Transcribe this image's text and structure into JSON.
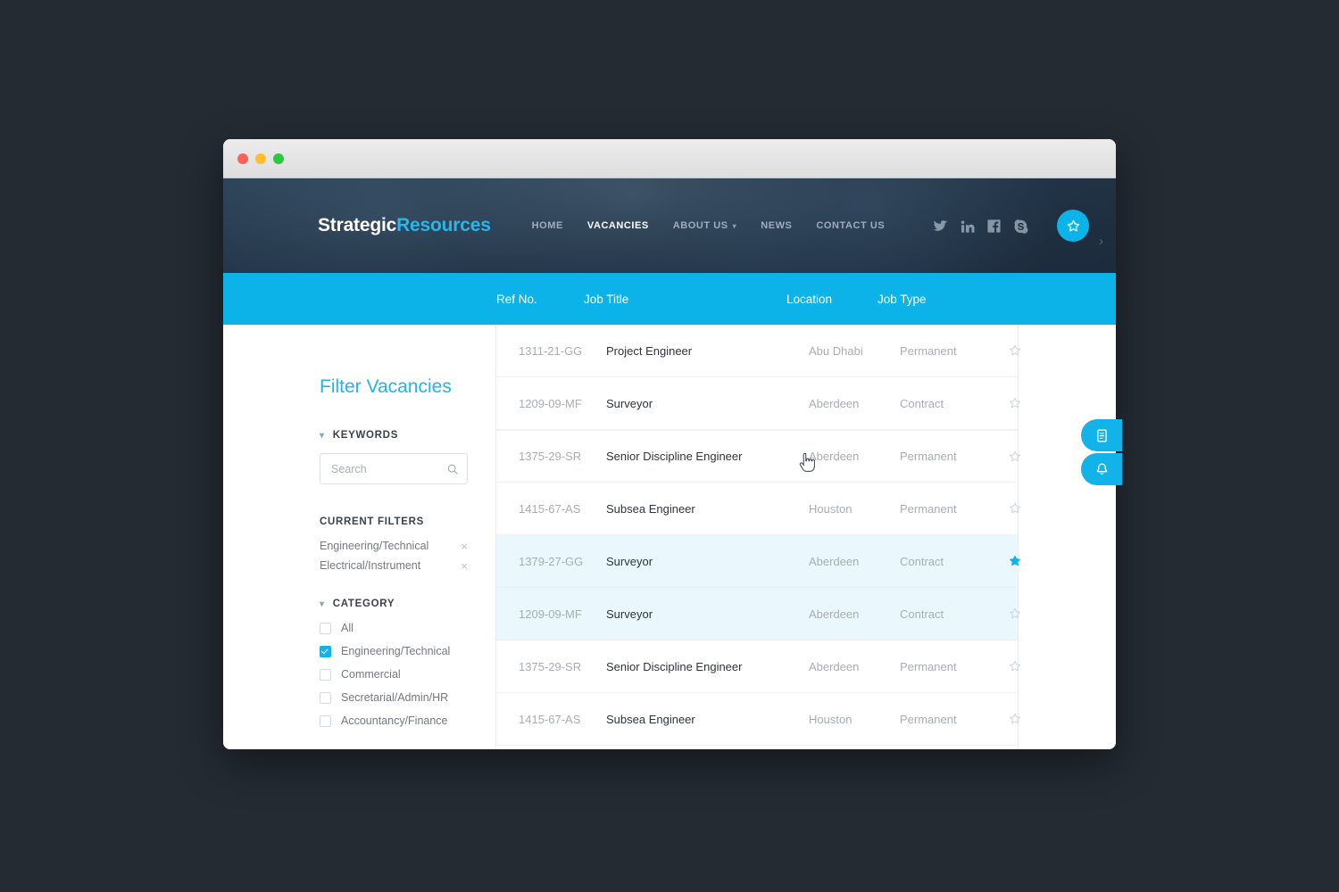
{
  "window": {
    "traffic_lights": [
      "close",
      "minimize",
      "maximize"
    ]
  },
  "header": {
    "brand_primary": "Strategic",
    "brand_secondary": "Resources",
    "nav": [
      {
        "label": "HOME",
        "active": false,
        "caret": false
      },
      {
        "label": "VACANCIES",
        "active": true,
        "caret": false
      },
      {
        "label": "ABOUT US",
        "active": false,
        "caret": true
      },
      {
        "label": "NEWS",
        "active": false,
        "caret": false
      },
      {
        "label": "CONTACT US",
        "active": false,
        "caret": false
      }
    ],
    "social": [
      "twitter-icon",
      "linkedin-icon",
      "facebook-icon",
      "skype-icon"
    ],
    "star_button_icon": "star-outline-icon",
    "carousel_next": "›"
  },
  "table": {
    "columns": [
      "Ref No.",
      "Job Title",
      "Location",
      "Job Type"
    ],
    "rows": [
      {
        "ref": "1311-21-GG",
        "title": "Project Engineer",
        "location": "Abu Dhabi",
        "type": "Permanent",
        "starred": false,
        "state": "normal"
      },
      {
        "ref": "1209-09-MF",
        "title": "Surveyor",
        "location": "Aberdeen",
        "type": "Contract",
        "starred": false,
        "state": "normal"
      },
      {
        "ref": "1375-29-SR",
        "title": "Senior Discipline Engineer",
        "location": "Aberdeen",
        "type": "Permanent",
        "starred": false,
        "state": "hovered"
      },
      {
        "ref": "1415-67-AS",
        "title": "Subsea Engineer",
        "location": "Houston",
        "type": "Permanent",
        "starred": false,
        "state": "normal"
      },
      {
        "ref": "1379-27-GG",
        "title": "Surveyor",
        "location": "Aberdeen",
        "type": "Contract",
        "starred": true,
        "state": "selected"
      },
      {
        "ref": "1209-09-MF",
        "title": "Surveyor",
        "location": "Aberdeen",
        "type": "Contract",
        "starred": false,
        "state": "selected"
      },
      {
        "ref": "1375-29-SR",
        "title": "Senior Discipline Engineer",
        "location": "Aberdeen",
        "type": "Permanent",
        "starred": false,
        "state": "normal"
      },
      {
        "ref": "1415-67-AS",
        "title": "Subsea Engineer",
        "location": "Houston",
        "type": "Permanent",
        "starred": false,
        "state": "normal"
      }
    ]
  },
  "sidebar": {
    "title": "Filter Vacancies",
    "keywords_heading": "KEYWORDS",
    "search": {
      "value": "",
      "placeholder": "Search"
    },
    "current_filters_heading": "CURRENT FILTERS",
    "current_filters": [
      {
        "label": "Engineering/Technical",
        "remove": "×"
      },
      {
        "label": "Electrical/Instrument",
        "remove": "×"
      }
    ],
    "category_heading": "CATEGORY",
    "categories": [
      {
        "label": "All",
        "checked": false
      },
      {
        "label": "Engineering/Technical",
        "checked": true
      },
      {
        "label": "Commercial",
        "checked": false
      },
      {
        "label": "Secretarial/Admin/HR",
        "checked": false
      },
      {
        "label": "Accountancy/Finance",
        "checked": false
      }
    ]
  },
  "side_tabs": [
    {
      "icon": "document-list-icon"
    },
    {
      "icon": "bell-icon"
    }
  ],
  "colors": {
    "accent": "#0bb3e8",
    "accent_dark": "#11b3e8",
    "header_dark": "#26384a",
    "selected_row": "#eaf8fe",
    "page_background": "#242b33",
    "text_muted": "#a6aeb4",
    "text_dark": "#2e3539"
  }
}
